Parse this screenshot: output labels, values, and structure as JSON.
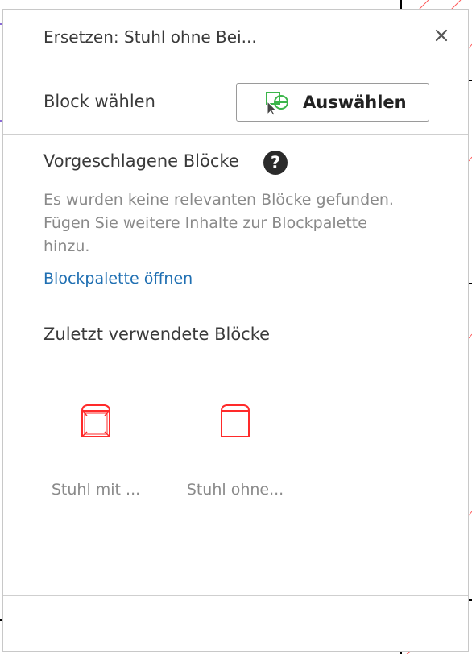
{
  "dialog": {
    "title": "Ersetzen: Stuhl ohne Bei...",
    "close_icon": "close-icon"
  },
  "select_row": {
    "label": "Block wählen",
    "button_label": "Auswählen",
    "button_icon": "select-block-icon"
  },
  "suggested": {
    "title": "Vorgeschlagene Blöcke",
    "help_icon": "help-icon",
    "info_line1": "Es wurden keine relevanten Blöcke gefunden.",
    "info_line2": "Fügen Sie weitere Inhalte zur Blockpalette",
    "info_line3": "hinzu.",
    "link": "Blockpalette öffnen"
  },
  "recent": {
    "title": "Zuletzt verwendete Blöcke",
    "items": [
      {
        "label": "Stuhl mit ...",
        "icon": "chair-block-icon"
      },
      {
        "label": "Stuhl ohne...",
        "icon": "chair-block-icon"
      }
    ]
  },
  "colors": {
    "accent_link": "#1f6fb2",
    "block_red": "#ff2a2a",
    "select_icon_green": "#3bb54a"
  }
}
